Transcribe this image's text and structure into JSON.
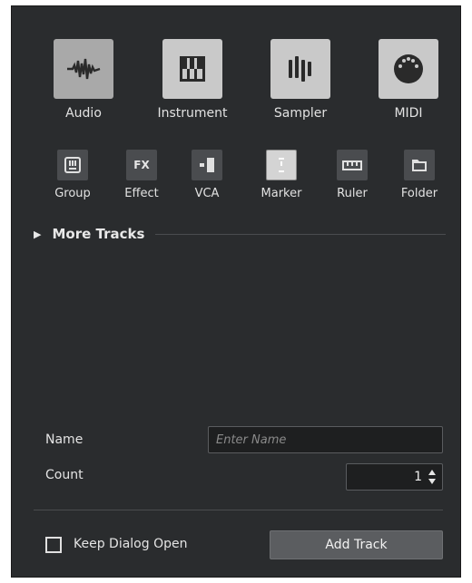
{
  "track_types_main": [
    {
      "label": "Audio",
      "icon": "waveform-icon"
    },
    {
      "label": "Instrument",
      "icon": "piano-keys-icon"
    },
    {
      "label": "Sampler",
      "icon": "sampler-bars-icon"
    },
    {
      "label": "MIDI",
      "icon": "midi-port-icon"
    }
  ],
  "track_types_small": [
    {
      "label": "Group",
      "icon": "group-icon"
    },
    {
      "label": "Effect",
      "icon": "fx-icon",
      "glyph": "FX"
    },
    {
      "label": "VCA",
      "icon": "vca-icon"
    },
    {
      "label": "Marker",
      "icon": "marker-icon"
    },
    {
      "label": "Ruler",
      "icon": "ruler-icon"
    },
    {
      "label": "Folder",
      "icon": "folder-icon"
    }
  ],
  "more_tracks": {
    "label": "More Tracks"
  },
  "name_field": {
    "label": "Name",
    "placeholder": "Enter Name",
    "value": ""
  },
  "count_field": {
    "label": "Count",
    "value": "1"
  },
  "keep_dialog": {
    "label": "Keep Dialog Open",
    "checked": false
  },
  "add_track": {
    "label": "Add Track"
  },
  "colors": {
    "background": "#2a2c2e",
    "tile": "#c9c9c9",
    "tile_selected": "#a9a9a9",
    "small_tile": "#4a4c4f",
    "button": "#5b5d60"
  }
}
